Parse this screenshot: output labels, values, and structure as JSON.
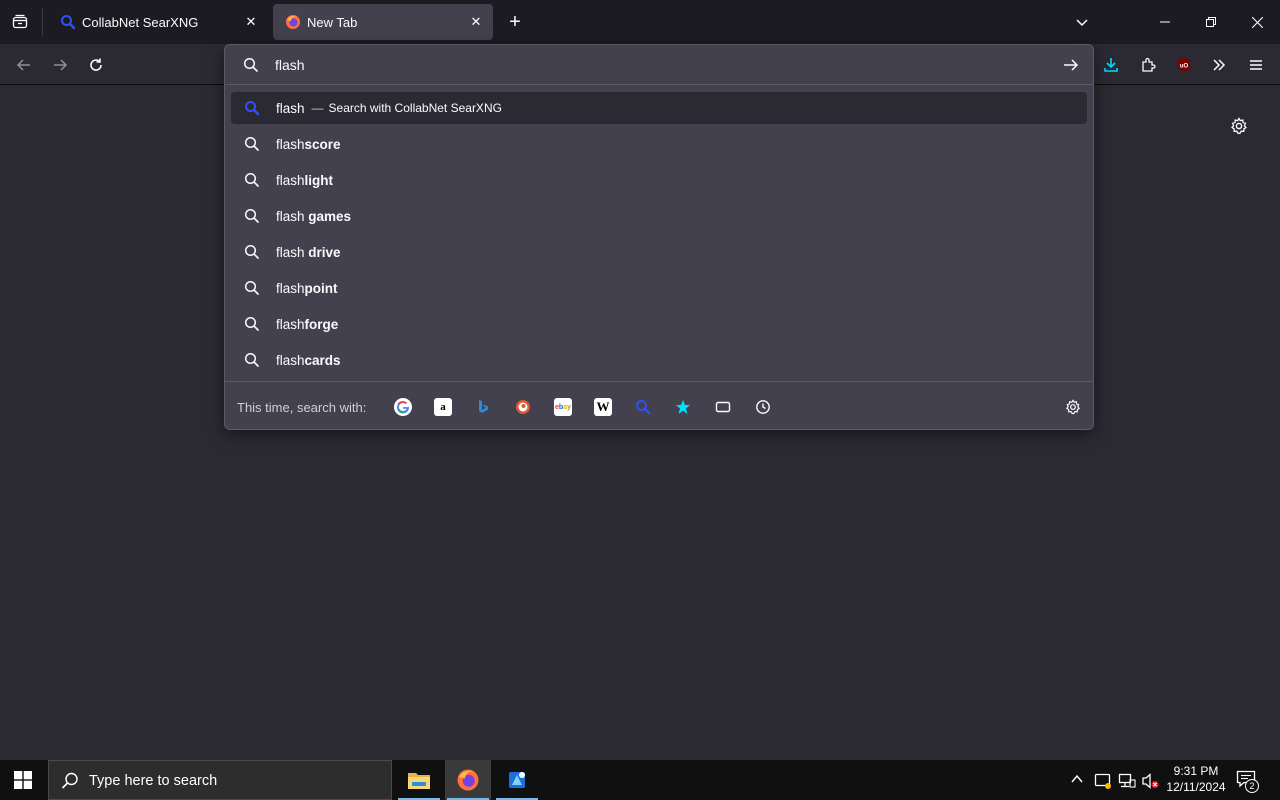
{
  "tabs": [
    {
      "title": "CollabNet SearXNG",
      "active": false
    },
    {
      "title": "New Tab",
      "active": true
    }
  ],
  "urlbar": {
    "value": "flash",
    "results": [
      {
        "typed": "flash",
        "suffix": "",
        "action": "Search with CollabNet SearXNG",
        "separator": "—",
        "selected": true
      },
      {
        "typed": "flash",
        "suffix": "score"
      },
      {
        "typed": "flash",
        "suffix": "light"
      },
      {
        "typed": "flash ",
        "suffix": "games"
      },
      {
        "typed": "flash ",
        "suffix": "drive"
      },
      {
        "typed": "flash",
        "suffix": "point"
      },
      {
        "typed": "flash",
        "suffix": "forge"
      },
      {
        "typed": "flash",
        "suffix": "cards"
      }
    ],
    "oneoff_label": "This time, search with:",
    "engines": [
      "google-icon",
      "amazon-icon",
      "bing-icon",
      "duckduckgo-icon",
      "ebay-icon",
      "wikipedia-icon",
      "searxng-icon",
      "bookmarks-icon",
      "tabs-icon",
      "history-icon"
    ]
  },
  "taskbar": {
    "search_placeholder": "Type here to search",
    "time": "9:31 PM",
    "date": "12/11/2024",
    "notification_count": "2"
  },
  "colors": {
    "accent": "#00ddff",
    "searx_blue": "#3050ff",
    "background": "#2b2a33",
    "popup": "#42414d"
  }
}
